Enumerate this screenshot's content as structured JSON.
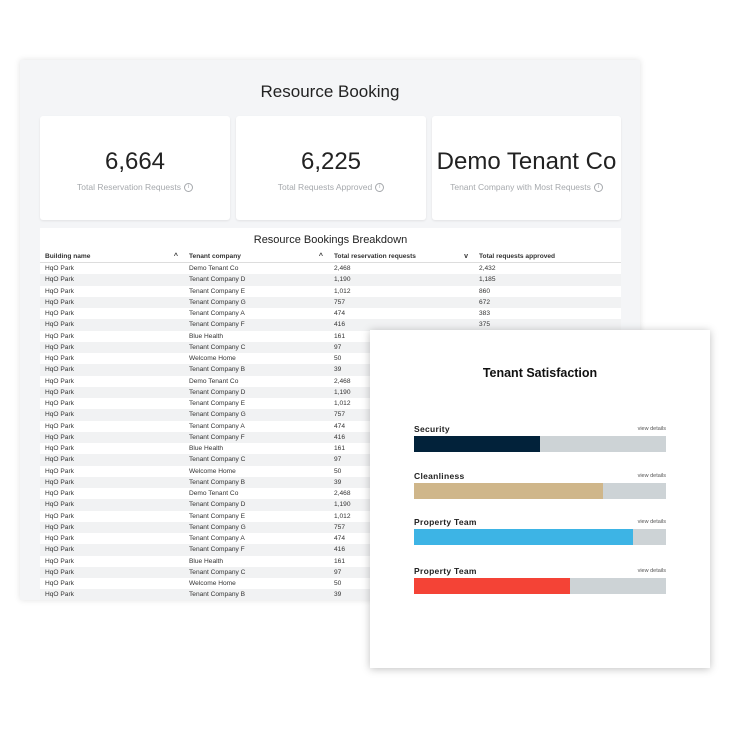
{
  "dashboard": {
    "title": "Resource Booking",
    "kpis": [
      {
        "value": "6,664",
        "label": "Total Reservation Requests"
      },
      {
        "value": "6,225",
        "label": "Total Requests Approved"
      },
      {
        "value": "Demo Tenant Co",
        "label": "Tenant Company with Most Requests"
      }
    ],
    "info_icon": "i",
    "table": {
      "title": "Resource Bookings Breakdown",
      "columns": [
        "Building name",
        "Tenant company",
        "Total reservation requests",
        "Total requests approved"
      ],
      "sort_icon": "^",
      "sort_down_icon": "v",
      "rows": [
        [
          "HqO Park",
          "Demo Tenant Co",
          "2,468",
          "2,432"
        ],
        [
          "HqO Park",
          "Tenant Company D",
          "1,190",
          "1,185"
        ],
        [
          "HqO Park",
          "Tenant Company E",
          "1,012",
          "860"
        ],
        [
          "HqO Park",
          "Tenant Company G",
          "757",
          "672"
        ],
        [
          "HqO Park",
          "Tenant Company A",
          "474",
          "383"
        ],
        [
          "HqO Park",
          "Tenant Company F",
          "416",
          "375"
        ],
        [
          "HqO Park",
          "Blue Health",
          "161",
          ""
        ],
        [
          "HqO Park",
          "Tenant Company C",
          "97",
          ""
        ],
        [
          "HqO Park",
          "Welcome Home",
          "50",
          ""
        ],
        [
          "HqO Park",
          "Tenant Company B",
          "39",
          ""
        ],
        [
          "HqO Park",
          "Demo Tenant Co",
          "2,468",
          ""
        ],
        [
          "HqO Park",
          "Tenant Company D",
          "1,190",
          ""
        ],
        [
          "HqO Park",
          "Tenant Company E",
          "1,012",
          ""
        ],
        [
          "HqO Park",
          "Tenant Company G",
          "757",
          ""
        ],
        [
          "HqO Park",
          "Tenant Company A",
          "474",
          ""
        ],
        [
          "HqO Park",
          "Tenant Company F",
          "416",
          ""
        ],
        [
          "HqO Park",
          "Blue Health",
          "161",
          ""
        ],
        [
          "HqO Park",
          "Tenant Company C",
          "97",
          ""
        ],
        [
          "HqO Park",
          "Welcome Home",
          "50",
          ""
        ],
        [
          "HqO Park",
          "Tenant Company B",
          "39",
          ""
        ],
        [
          "HqO Park",
          "Demo Tenant Co",
          "2,468",
          ""
        ],
        [
          "HqO Park",
          "Tenant Company D",
          "1,190",
          ""
        ],
        [
          "HqO Park",
          "Tenant Company E",
          "1,012",
          ""
        ],
        [
          "HqO Park",
          "Tenant Company G",
          "757",
          ""
        ],
        [
          "HqO Park",
          "Tenant Company A",
          "474",
          ""
        ],
        [
          "HqO Park",
          "Tenant Company F",
          "416",
          ""
        ],
        [
          "HqO Park",
          "Blue Health",
          "161",
          ""
        ],
        [
          "HqO Park",
          "Tenant Company C",
          "97",
          ""
        ],
        [
          "HqO Park",
          "Welcome Home",
          "50",
          ""
        ],
        [
          "HqO Park",
          "Tenant Company B",
          "39",
          ""
        ]
      ]
    }
  },
  "satisfaction": {
    "title": "Tenant Satisfaction",
    "metrics": [
      {
        "name": "Security",
        "link": "view details",
        "fraction": 0.5,
        "color": "#02223a"
      },
      {
        "name": "Cleanliness",
        "link": "view details",
        "fraction": 0.75,
        "color": "#cfb68a"
      },
      {
        "name": "Property Team",
        "link": "view details",
        "fraction": 0.87,
        "color": "#3db4e5"
      },
      {
        "name": "Property Team",
        "link": "view details",
        "fraction": 0.62,
        "color": "#f44336"
      }
    ]
  }
}
